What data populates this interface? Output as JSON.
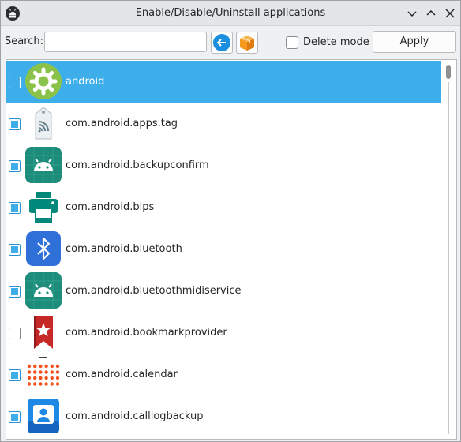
{
  "window": {
    "title": "Enable/Disable/Uninstall applications"
  },
  "toolbar": {
    "search_label": "Search:",
    "search_value": "",
    "delete_mode_label": "Delete mode",
    "delete_mode_checked": false,
    "apply_label": "Apply"
  },
  "apps": [
    {
      "name": "android",
      "checked": false,
      "selected": true,
      "icon": "gear-icon"
    },
    {
      "name": "com.android.apps.tag",
      "checked": true,
      "selected": false,
      "icon": "nfc-tag-icon"
    },
    {
      "name": "com.android.backupconfirm",
      "checked": true,
      "selected": false,
      "icon": "android-robot-icon"
    },
    {
      "name": "com.android.bips",
      "checked": true,
      "selected": false,
      "icon": "printer-icon"
    },
    {
      "name": "com.android.bluetooth",
      "checked": true,
      "selected": false,
      "icon": "bluetooth-icon"
    },
    {
      "name": "com.android.bluetoothmidiservice",
      "checked": true,
      "selected": false,
      "icon": "android-robot-icon"
    },
    {
      "name": "com.android.bookmarkprovider",
      "checked": false,
      "selected": false,
      "icon": "bookmark-star-icon"
    },
    {
      "name": "com.android.calendar",
      "checked": true,
      "selected": false,
      "icon": "calendar-dots-icon"
    },
    {
      "name": "com.android.calllogbackup",
      "checked": true,
      "selected": false,
      "icon": "contacts-icon"
    }
  ],
  "colors": {
    "selection": "#3daee9",
    "accent": "#3daee9",
    "android_green": "#1e8c7a"
  }
}
